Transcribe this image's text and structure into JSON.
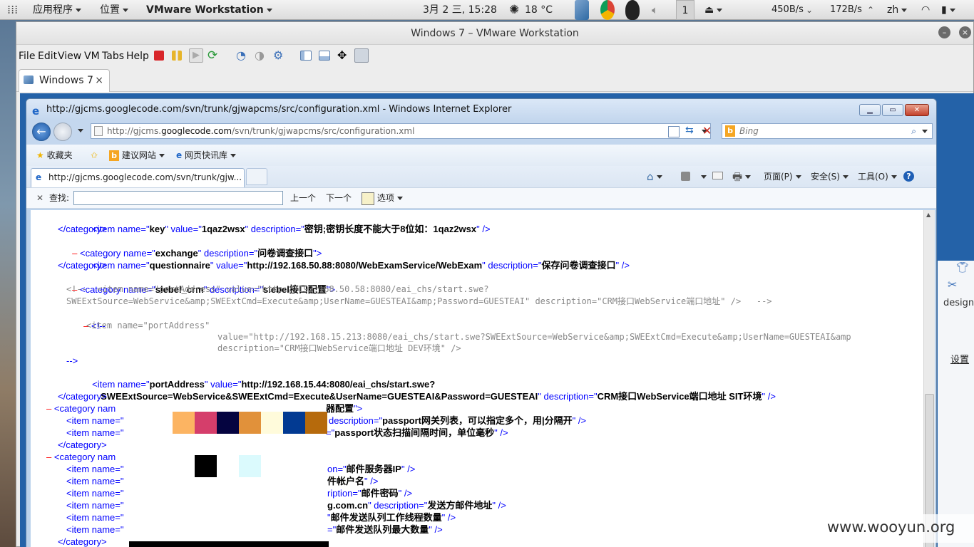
{
  "top_panel": {
    "apps_menu": "应用程序",
    "places_menu": "位置",
    "active_app": "VMware Workstation",
    "datetime": "3月 2 三, 15:28",
    "weather": "18 °C",
    "workspace": "1",
    "net_down": "450B/s",
    "net_up": "172B/s",
    "input_method": "zh"
  },
  "vmware": {
    "title": "Windows 7 – VMware Workstation",
    "menu": {
      "file": "File",
      "edit": "Edit",
      "view": "View",
      "vm": "VM",
      "tabs": "Tabs",
      "help": "Help"
    },
    "tab_label": "Windows 7",
    "tab_close": "×"
  },
  "ie": {
    "title": "http://gjcms.googlecode.com/svn/trunk/gjwapcms/src/configuration.xml - Windows Internet Explorer",
    "address_prefix": "http://gjcms.",
    "address_host": "googlecode.com",
    "address_path": "/svn/trunk/gjwapcms/src/configuration.xml",
    "search_placeholder": "Bing",
    "favorites": "收藏夹",
    "suggested_sites": "建议网站",
    "web_slice": "网页快讯库",
    "tab_title": "http://gjcms.googlecode.com/svn/trunk/gjw...",
    "cmd_page": "页面(P)",
    "cmd_safety": "安全(S)",
    "cmd_tools": "工具(O)",
    "find_label": "查找:",
    "find_prev": "上一个",
    "find_next": "下一个",
    "find_options": "选项"
  },
  "guest_side": {
    "design_label": "design",
    "settings_label": "设置"
  },
  "redaction_colors": [
    "#fcb462",
    "#d53e6b",
    "#050440",
    "#e1913a",
    "#fffbdb",
    "#023a92",
    "#b66a0c",
    "#000000",
    "#dbfafd"
  ],
  "watermark": "www.wooyun.org",
  "xml": {
    "l1": {
      "tag": "<item name=\"",
      "name": "key",
      "mid": "\" value=\"",
      "value": "1qaz2wsx",
      "mid2": "\" description=\"",
      "desc": "密钥;密钥长度不能大于8位如：1qaz2wsx",
      "end": "\" />"
    },
    "l2": "</category>",
    "l3": {
      "tag": "<category name=\"",
      "name": "exchange",
      "mid": "\" description=\"",
      "desc": "问卷调查接口",
      "end": "\">"
    },
    "l4": {
      "tag": "<item name=\"",
      "name": "questionnaire",
      "mid": "\" value=\"",
      "value": "http://192.168.50.88:8080/WebExamService/WebExam",
      "mid2": "\" description=\"",
      "desc": "保存问卷调查接口",
      "end": "\" />"
    },
    "l5": "</category>",
    "l6": {
      "tag": "<category name=\"",
      "name": "siebel_crm",
      "mid": "\" description=\"",
      "desc": "siebel接口配置",
      "end": "\">"
    },
    "l7": "<!--  <item name=\"portAddress\" value=\"http://192.168.50.58:8080/eai_chs/start.swe?",
    "l8": "SWEExtSource=WebService&amp;SWEExtCmd=Execute&amp;UserName=GUESTEAI&amp;Password=GUESTEAI\" description=\"CRM接口WebService端口地址\" />   -->",
    "l9": "<!--",
    "l10": "<item name=\"portAddress\"",
    "l11": "value=\"http://192.168.15.213:8080/eai_chs/start.swe?SWEExtSource=WebService&amp;SWEExtCmd=Execute&amp;UserName=GUESTEAI&amp",
    "l12": "description=\"CRM接口WebService端口地址 DEV环境\" />",
    "l13": "-->",
    "l14": {
      "tag": "<item name=\"",
      "name": "portAddress",
      "mid": "\" value=\"",
      "value": "http://192.168.15.44:8080/eai_chs/start.swe?"
    },
    "l15": {
      "value": "SWEExtSource=WebService&SWEExtCmd=Execute&UserName=GUESTEAI&Password=GUESTEAI",
      "mid2": "\" description=\"",
      "desc": "CRM接口WebService端口地址 SIT环境",
      "end": "\" />"
    },
    "l16": "</category>",
    "l17": {
      "left": "<category nam",
      "right_desc": "器配置",
      "right_end": "\">"
    },
    "l18": {
      "left": "<item name=\"",
      "right_mid": "description=\"",
      "right_desc": "passport网关列表，可以指定多个，用|分隔开",
      "right_end": "\" />"
    },
    "l19": {
      "left": "<item name=\"",
      "right_mid": "=\"",
      "right_desc": "passport状态扫描间隔时间，单位毫秒",
      "right_end": "\" />"
    },
    "l20": "</category>",
    "l21": {
      "left": "<category nam"
    },
    "l22": {
      "left": "<item name=\"",
      "right_mid": "on=\"",
      "right_desc": "邮件服务器IP",
      "right_end": "\" />"
    },
    "l23": {
      "left": "<item name=\"",
      "right_desc": "件帐户名",
      "right_end": "\" />"
    },
    "l24": {
      "left": "<item name=\"",
      "right_mid": "ription=\"",
      "right_desc": "邮件密码",
      "right_end": "\" />"
    },
    "l25": {
      "left": "<item name=\"",
      "right_value": "g.com.cn",
      "right_mid": "\" description=\"",
      "right_desc": "发送方邮件地址",
      "right_end": "\" />"
    },
    "l26": {
      "left": "<item name=\"",
      "right_mid": "\"",
      "right_desc": "邮件发送队列工作线程数量",
      "right_end": "\" />"
    },
    "l27": {
      "left": "<item name=\"",
      "right_mid": "=\"",
      "right_desc": "邮件发送队列最大数量",
      "right_end": "\" />"
    },
    "l28": "</category>",
    "toggle": "–"
  }
}
